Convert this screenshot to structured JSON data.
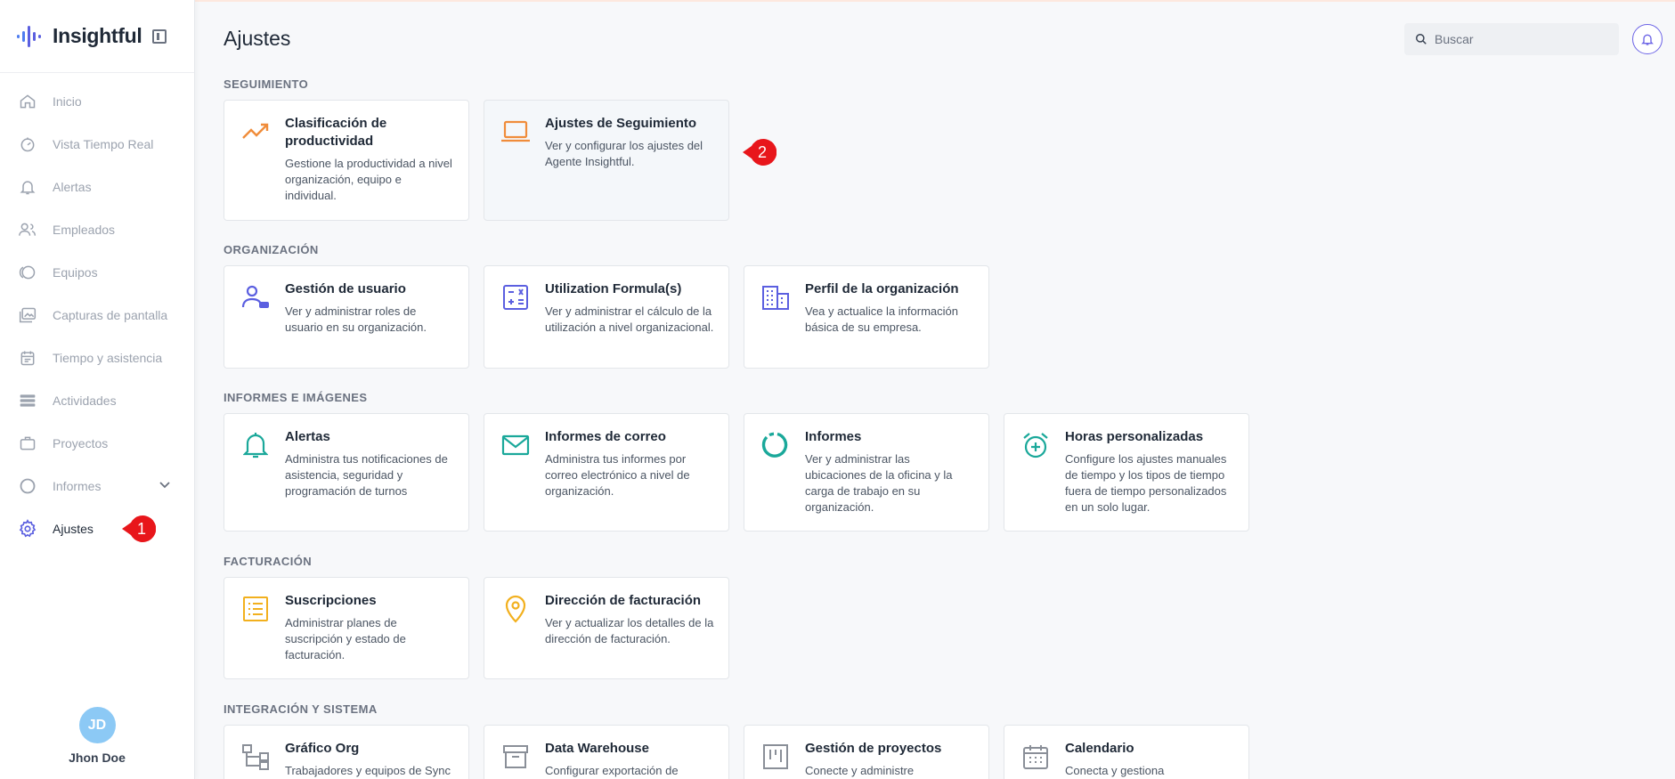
{
  "app": {
    "brand": "Insightful"
  },
  "sidebar": {
    "items": [
      {
        "label": "Inicio",
        "icon": "home-icon"
      },
      {
        "label": "Vista Tiempo Real",
        "icon": "realtime-icon"
      },
      {
        "label": "Alertas",
        "icon": "bell-icon"
      },
      {
        "label": "Empleados",
        "icon": "users-icon"
      },
      {
        "label": "Equipos",
        "icon": "teams-icon"
      },
      {
        "label": "Capturas de pantalla",
        "icon": "screenshots-icon"
      },
      {
        "label": "Tiempo y asistencia",
        "icon": "calendar-icon"
      },
      {
        "label": "Actividades",
        "icon": "activities-icon"
      },
      {
        "label": "Proyectos",
        "icon": "briefcase-icon"
      },
      {
        "label": "Informes",
        "icon": "reports-icon"
      },
      {
        "label": "Ajustes",
        "icon": "gear-icon"
      }
    ],
    "user": {
      "initials": "JD",
      "name": "Jhon Doe"
    }
  },
  "header": {
    "title": "Ajustes",
    "search_placeholder": "Buscar"
  },
  "annotations": {
    "badge1": "1",
    "badge2": "2",
    "badge_color": "#e8161b"
  },
  "sections": {
    "seguimiento": {
      "title": "SEGUIMIENTO",
      "cards": [
        {
          "title": "Clasificación de productividad",
          "desc": "Gestione la productividad a nivel organización, equipo e individual."
        },
        {
          "title": "Ajustes de Seguimiento",
          "desc": "Ver y configurar los ajustes del Agente Insightful."
        }
      ]
    },
    "organizacion": {
      "title": "ORGANIZACIÓN",
      "cards": [
        {
          "title": "Gestión de usuario",
          "desc": "Ver y administrar roles de usuario en su organización."
        },
        {
          "title": "Utilization Formula(s)",
          "desc": "Ver y administrar el cálculo de la utilización a nivel organizacional."
        },
        {
          "title": "Perfil de la organización",
          "desc": "Vea y actualice la información básica de su empresa."
        }
      ]
    },
    "informes": {
      "title": "INFORMES E IMÁGENES",
      "cards": [
        {
          "title": "Alertas",
          "desc": "Administra tus notificaciones de asistencia, seguridad y programación de turnos"
        },
        {
          "title": "Informes de correo",
          "desc": "Administra tus informes por correo electrónico a nivel de organización."
        },
        {
          "title": "Informes",
          "desc": "Ver y administrar las ubicaciones de la oficina y la carga de trabajo en su organización."
        },
        {
          "title": "Horas personalizadas",
          "desc": "Configure los ajustes manuales de tiempo y los tipos de tiempo fuera de tiempo personalizados en un solo lugar."
        }
      ]
    },
    "facturacion": {
      "title": "FACTURACIÓN",
      "cards": [
        {
          "title": "Suscripciones",
          "desc": "Administrar planes de suscripción y estado de facturación."
        },
        {
          "title": "Dirección de facturación",
          "desc": "Ver y actualizar los detalles de la dirección de facturación."
        }
      ]
    },
    "integracion": {
      "title": "INTEGRACIÓN Y SISTEMA",
      "cards": [
        {
          "title": "Gráfico Org",
          "desc": "Trabajadores y equipos de Sync"
        },
        {
          "title": "Data Warehouse",
          "desc": "Configurar exportación de"
        },
        {
          "title": "Gestión de proyectos",
          "desc": "Conecte y administre"
        },
        {
          "title": "Calendario",
          "desc": "Conecta y gestiona"
        }
      ]
    }
  }
}
